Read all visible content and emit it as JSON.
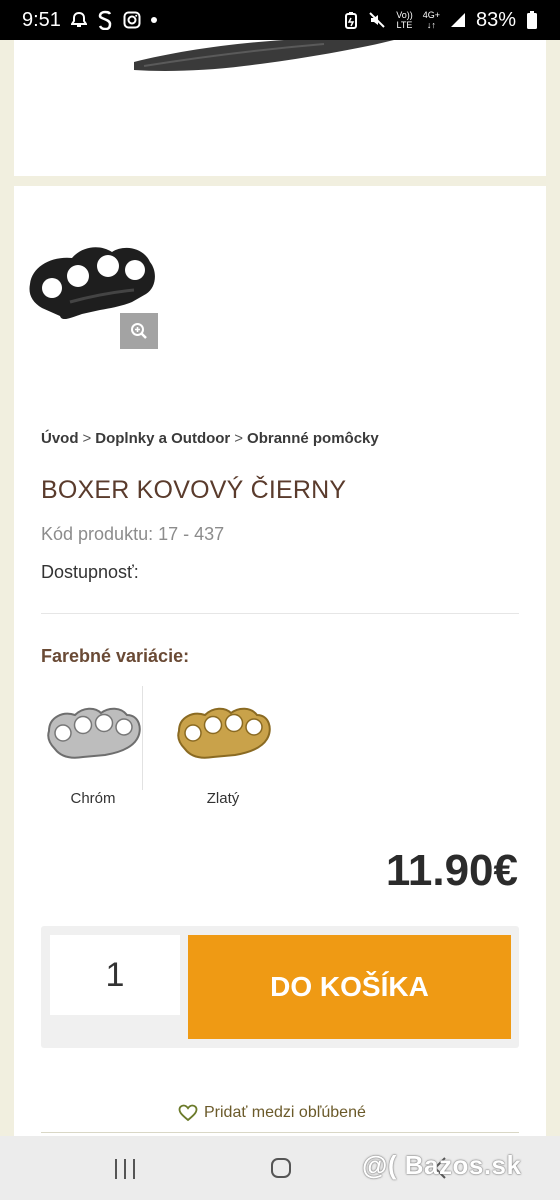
{
  "status_bar": {
    "time": "9:51",
    "network_top": "Vo))",
    "network_bottom": "LTE",
    "network_type": "4G+",
    "battery": "83%"
  },
  "breadcrumb": {
    "home": "Úvod",
    "category": "Doplnky a Outdoor",
    "subcategory": "Obranné pomôcky",
    "separator": ">"
  },
  "product": {
    "title": "BOXER KOVOVÝ ČIERNY",
    "code": "Kód produktu: 17 - 437",
    "availability": "Dostupnosť:",
    "price": "11.90€"
  },
  "variants": {
    "heading": "Farebné variácie:",
    "items": [
      {
        "label": "Chróm",
        "color": "#c8c8c8"
      },
      {
        "label": "Zlatý",
        "color": "#c9a24a"
      }
    ]
  },
  "cart": {
    "quantity": "1",
    "button_label": "DO KOŠÍKA"
  },
  "favorites": {
    "label": "Pridať medzi obľúbené"
  },
  "watermark": "@( Bazos.sk",
  "colors": {
    "accent": "#ef9a14",
    "title": "#5a3b2c",
    "background": "#f1efdf"
  }
}
